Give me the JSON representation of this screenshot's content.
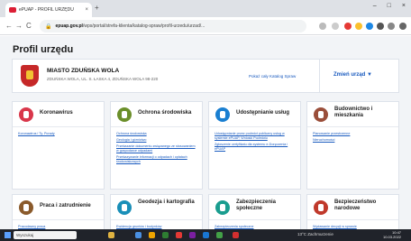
{
  "browser": {
    "tab_title": "ePUAP - PROFIL URZĘDU",
    "tab_close": "×",
    "new_tab": "+",
    "win_controls": [
      "–",
      "□",
      "×"
    ],
    "nav": [
      "←",
      "→",
      "C"
    ],
    "lock": "🔒",
    "url_domain": "epuap.gov.pl",
    "url_path": "/wps/portal/strefa-klienta/katalog-spraw/profil-urzedu/urzad/..."
  },
  "page": {
    "heading": "Profil urzędu",
    "office": {
      "name": "MIASTO ZDUŃSKA WOLA",
      "address": "ZDUŃSKA WOLA, UL. S. ŁASKA 4, ZDUŃSKA WOLA 98-220",
      "catalog_link": "Pokaż cały Katalog Spraw",
      "change_label": "Zmień urząd ▼"
    },
    "cards": [
      {
        "title": "Koronawirus",
        "color": "#d9374b",
        "links": [
          "Koronawirus i Ty. Porady"
        ]
      },
      {
        "title": "Ochrona środowiska",
        "color": "#6b8f2a",
        "links": [
          "Ochrona środowiska",
          "Geologia i górnictwo",
          "Przekazanie dokumentu związanego ze stosowaniem w gospodarce odpadami",
          "Przekazywanie informacji o odpadach i opłatach środowiskowych"
        ]
      },
      {
        "title": "Udostępnianie usług",
        "color": "#1a7fd1",
        "links": [
          "Udostępnianie przez podmiot publiczny usług w systemie ePUAP, Wnioski Podmiotu",
          "Zgłoszenie certyfikatu dla systemu e-Doręczenia i ePUAP"
        ]
      },
      {
        "title": "Budownictwo i mieszkania",
        "color": "#9a4e3a",
        "links": [
          "Planowanie przestrzenne",
          "Nieruchomości"
        ]
      },
      {
        "title": "Praca i zatrudnienie",
        "color": "#8a5a2b",
        "links": [
          "Pracodawcy praca"
        ]
      },
      {
        "title": "Geodezja i kartografia",
        "color": "#1a8fb8",
        "links": [
          "Ewidencja gruntów i budynków"
        ]
      },
      {
        "title": "Zabezpieczenia społeczne",
        "color": "#1a9d8f",
        "links": [
          "Zabezpieczenia społeczne"
        ]
      },
      {
        "title": "Bezpieczeństwo narodowe",
        "color": "#c0392b",
        "links": [
          "Wydawanie decyzji w sprawie"
        ]
      }
    ]
  },
  "taskbar": {
    "search_placeholder": "Wyszukaj",
    "tray_text": "13°C  Zachmurzenie",
    "time": "10:47",
    "date": "10.03.2022"
  }
}
